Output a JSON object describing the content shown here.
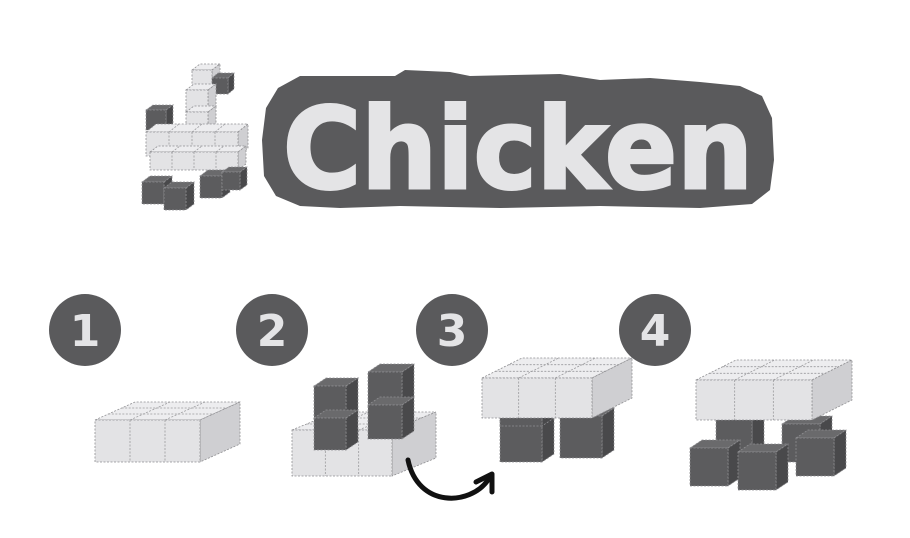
{
  "title": "Chicken",
  "steps": [
    {
      "number": "1"
    },
    {
      "number": "2"
    },
    {
      "number": "3"
    },
    {
      "number": "4"
    }
  ],
  "colors": {
    "light_cube": "#e3e3e5",
    "light_cube_side": "#cfcfd2",
    "dark_cube": "#5c5c5e",
    "dark_cube_side": "#49494b",
    "badge": "#5a5a5c",
    "title_fill": "#e4e4e6",
    "title_outline": "#5a5a5c",
    "arrow": "#111111"
  },
  "icons": [
    "chicken-figure",
    "curved-arrow-icon"
  ]
}
